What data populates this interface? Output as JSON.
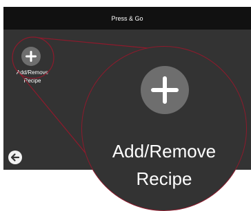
{
  "header": {
    "title": "Press & Go"
  },
  "tile": {
    "label_line1": "Add/Remove",
    "label_line2": "Recipe",
    "icon": "plus-icon"
  },
  "zoom": {
    "label_line1": "Add/Remove",
    "label_line2": "Recipe",
    "icon": "plus-icon"
  },
  "back": {
    "icon": "arrow-left-icon"
  },
  "colors": {
    "screen_bg": "#333333",
    "titlebar_bg": "#111111",
    "button_bg": "#6e6e6e",
    "callout_outline": "#8e1a2c"
  }
}
